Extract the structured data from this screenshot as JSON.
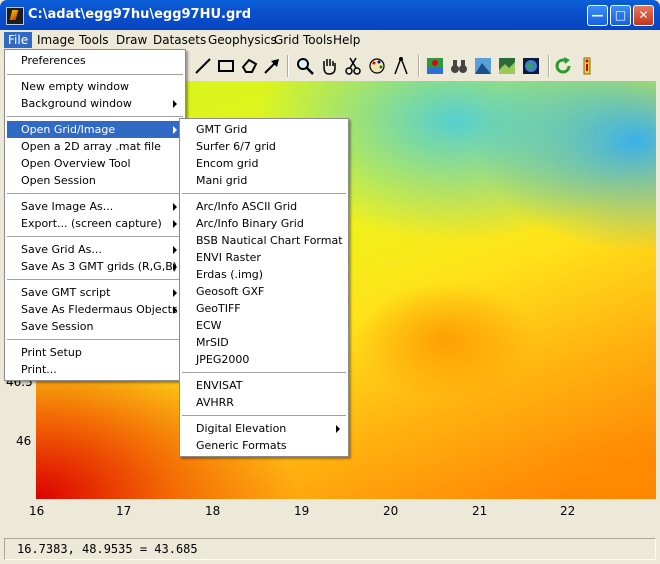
{
  "window": {
    "title": "C:\\adat\\egg97hu\\egg97HU.grd"
  },
  "menubar": [
    "File",
    "Image",
    "Tools",
    "Draw",
    "Datasets",
    "Geophysics",
    "Grid Tools",
    "Help"
  ],
  "file_menu": [
    {
      "label": "Preferences",
      "submenu": false
    },
    {
      "label": "New empty window",
      "submenu": false
    },
    {
      "label": "Background window",
      "submenu": true
    },
    {
      "label": "Open Grid/Image",
      "submenu": true,
      "highlighted": true
    },
    {
      "label": "Open a 2D array .mat file",
      "submenu": false
    },
    {
      "label": "Open Overview Tool",
      "submenu": false
    },
    {
      "label": "Open Session",
      "submenu": false
    },
    {
      "label": "Save Image As...",
      "submenu": true
    },
    {
      "label": "Export... (screen capture)",
      "submenu": true
    },
    {
      "label": "Save Grid As...",
      "submenu": true
    },
    {
      "label": "Save As 3 GMT grids (R,G,B)",
      "submenu": true
    },
    {
      "label": "Save GMT script",
      "submenu": true
    },
    {
      "label": "Save As Fledermaus Objects",
      "submenu": true
    },
    {
      "label": "Save Session",
      "submenu": false
    },
    {
      "label": "Print Setup",
      "submenu": false
    },
    {
      "label": "Print...",
      "submenu": false
    }
  ],
  "open_grid_submenu": [
    {
      "label": "GMT Grid",
      "submenu": false
    },
    {
      "label": "Surfer 6/7 grid",
      "submenu": false
    },
    {
      "label": "Encom grid",
      "submenu": false
    },
    {
      "label": "Mani grid",
      "submenu": false
    },
    {
      "label": "Arc/Info ASCII Grid",
      "submenu": false
    },
    {
      "label": "Arc/Info Binary Grid",
      "submenu": false
    },
    {
      "label": "BSB Nautical Chart Format",
      "submenu": false
    },
    {
      "label": "ENVI Raster",
      "submenu": false
    },
    {
      "label": "Erdas (.img)",
      "submenu": false
    },
    {
      "label": "Geosoft GXF",
      "submenu": false
    },
    {
      "label": "GeoTIFF",
      "submenu": false
    },
    {
      "label": "ECW",
      "submenu": false
    },
    {
      "label": "MrSID",
      "submenu": false
    },
    {
      "label": "JPEG2000",
      "submenu": false
    },
    {
      "label": "ENVISAT",
      "submenu": false
    },
    {
      "label": "AVHRR",
      "submenu": false
    },
    {
      "label": "Digital Elevation",
      "submenu": true
    },
    {
      "label": "Generic Formats",
      "submenu": false
    }
  ],
  "axes": {
    "x_ticks": [
      "16",
      "17",
      "18",
      "19",
      "20",
      "21",
      "22"
    ],
    "y_ticks": [
      "46.5",
      "46"
    ]
  },
  "statusbar": {
    "text": "16.7383, 48.9535 = 43.685"
  },
  "toolbar_icons": [
    "line-icon",
    "rectangle-icon",
    "polygon-icon",
    "arrow-icon",
    "zoom-icon",
    "pan-hand-icon",
    "scissors-icon",
    "color-palette-icon",
    "compass-icon",
    "map-landmark-icon",
    "binoculars-icon",
    "shade-image-icon",
    "terrain-icon",
    "globe-icon",
    "refresh-icon",
    "info-icon"
  ]
}
